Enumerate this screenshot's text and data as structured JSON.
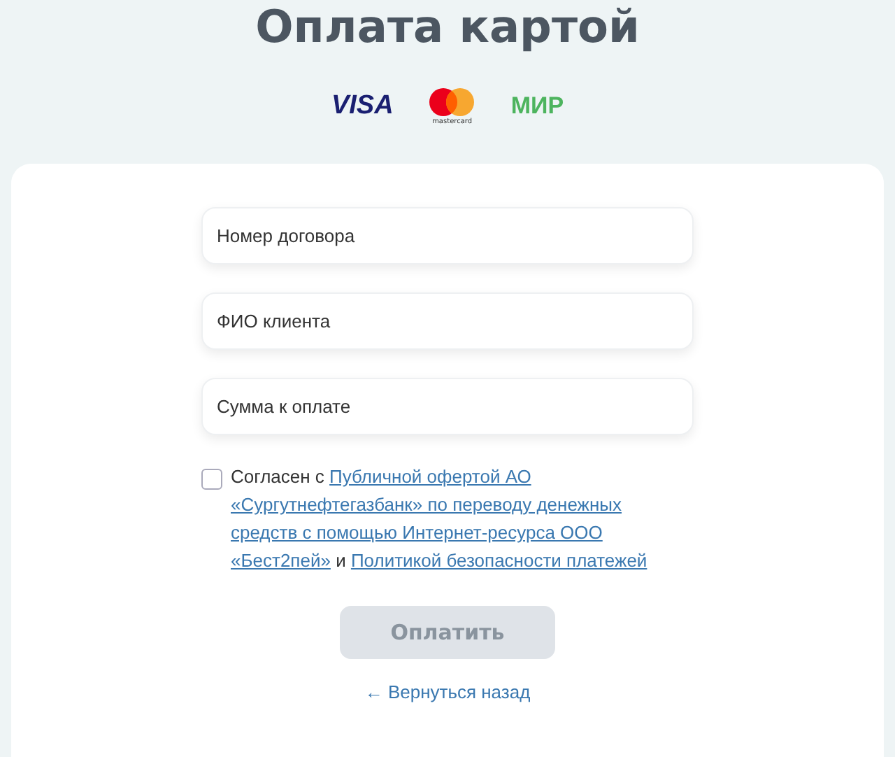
{
  "title": "Оплата картой",
  "logos": {
    "visa": "VISA",
    "mastercard": "mastercard",
    "mir": "МИР"
  },
  "fields": [
    {
      "placeholder": "Номер договора"
    },
    {
      "placeholder": "ФИО клиента"
    },
    {
      "placeholder": "Сумма к оплате"
    }
  ],
  "agreement": {
    "checked": false,
    "prefix": "Согласен с",
    "offer_link_lines": [
      "Публичной офертой АО",
      "«Сургутнефтегазбанк» по переводу денежных",
      "средств с помощью Интернет-ресурса ООО",
      "«Бест2пей»"
    ],
    "conjunction": "и",
    "policy_link": "Политикой безопасности платежей"
  },
  "pay_button": {
    "label": "Оплатить",
    "disabled": true
  },
  "back_link": {
    "arrow": "←",
    "label": "Вернуться назад"
  }
}
